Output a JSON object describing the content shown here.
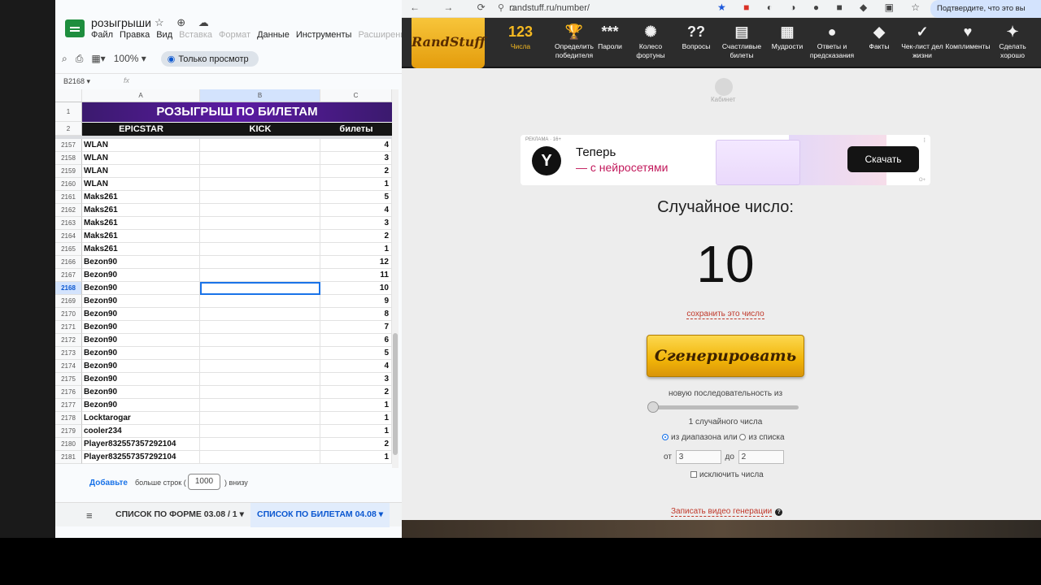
{
  "sheets": {
    "doc_title": "розыгрыши",
    "title_icons": "☆ ⊕ ☁",
    "menu": [
      {
        "label": "Файл",
        "dim": false
      },
      {
        "label": "Правка",
        "dim": false
      },
      {
        "label": "Вид",
        "dim": false
      },
      {
        "label": "Вставка",
        "dim": true
      },
      {
        "label": "Формат",
        "dim": true
      },
      {
        "label": "Данные",
        "dim": false
      },
      {
        "label": "Инструменты",
        "dim": false
      },
      {
        "label": "Расширения",
        "dim": true
      }
    ],
    "zoom": "100%",
    "view_only_label": "Только просмотр",
    "name_box": "B2168",
    "fx": "fx",
    "columns": [
      "A",
      "B",
      "C"
    ],
    "banner_row_num": "1",
    "header_row_num": "2",
    "banner": "РОЗЫГРЫШ ПО БИЛЕТАМ",
    "headers": [
      "EPICSTAR",
      "KICK",
      "билеты"
    ],
    "rows": [
      {
        "n": "2157",
        "a": "WLAN",
        "c": "4"
      },
      {
        "n": "2158",
        "a": "WLAN",
        "c": "3"
      },
      {
        "n": "2159",
        "a": "WLAN",
        "c": "2"
      },
      {
        "n": "2160",
        "a": "WLAN",
        "c": "1"
      },
      {
        "n": "2161",
        "a": "Maks261",
        "c": "5"
      },
      {
        "n": "2162",
        "a": "Maks261",
        "c": "4"
      },
      {
        "n": "2163",
        "a": "Maks261",
        "c": "3"
      },
      {
        "n": "2164",
        "a": "Maks261",
        "c": "2"
      },
      {
        "n": "2165",
        "a": "Maks261",
        "c": "1"
      },
      {
        "n": "2166",
        "a": "Bezon90",
        "c": "12"
      },
      {
        "n": "2167",
        "a": "Bezon90",
        "c": "11"
      },
      {
        "n": "2168",
        "a": "Bezon90",
        "c": "10",
        "selected": true
      },
      {
        "n": "2169",
        "a": "Bezon90",
        "c": "9"
      },
      {
        "n": "2170",
        "a": "Bezon90",
        "c": "8"
      },
      {
        "n": "2171",
        "a": "Bezon90",
        "c": "7"
      },
      {
        "n": "2172",
        "a": "Bezon90",
        "c": "6"
      },
      {
        "n": "2173",
        "a": "Bezon90",
        "c": "5"
      },
      {
        "n": "2174",
        "a": "Bezon90",
        "c": "4"
      },
      {
        "n": "2175",
        "a": "Bezon90",
        "c": "3"
      },
      {
        "n": "2176",
        "a": "Bezon90",
        "c": "2"
      },
      {
        "n": "2177",
        "a": "Bezon90",
        "c": "1"
      },
      {
        "n": "2178",
        "a": "Locktarogar",
        "c": "1"
      },
      {
        "n": "2179",
        "a": "cooler234",
        "c": "1"
      },
      {
        "n": "2180",
        "a": "Player832557357292104",
        "c": "2"
      },
      {
        "n": "2181",
        "a": "Player832557357292104",
        "c": "1"
      }
    ],
    "add_link": "Добавьте",
    "add_text": "больше строк (",
    "add_value": "1000",
    "add_below": ") внизу",
    "tab_menu_icon": "≡",
    "tabs": [
      "СПИСОК ПО ФОРМЕ 03.08 / 1 ▾",
      "СПИСОК ПО БИЛЕТАМ 04.08 ▾"
    ]
  },
  "browser": {
    "nav_icons": "← → ⟳ ⌂",
    "url": "randstuff.ru/number/",
    "confirm_label": "Подтвердите, что это вы"
  },
  "randstuff": {
    "logo": "RandStuff",
    "nav": [
      {
        "icon": "123",
        "label": "Числа",
        "active": true
      },
      {
        "icon": "🏆",
        "label": "Определить победителя"
      },
      {
        "icon": "***",
        "label": "Пароли"
      },
      {
        "icon": "✺",
        "label": "Колесо фортуны"
      },
      {
        "icon": "??",
        "label": "Вопросы"
      },
      {
        "icon": "▤",
        "label": "Счастливые билеты"
      },
      {
        "icon": "▦",
        "label": "Мудрости"
      },
      {
        "icon": "●",
        "label": "Ответы и предсказания"
      },
      {
        "icon": "◆",
        "label": "Факты"
      },
      {
        "icon": "✓",
        "label": "Чек-лист дел жизни"
      },
      {
        "icon": "♥",
        "label": "Комплименты"
      },
      {
        "icon": "✦",
        "label": "Сделать хорошо"
      }
    ],
    "cabinet_label": "Кабинет",
    "ad": {
      "tag": "РЕКЛАМА · 16+",
      "logo_letter": "Y",
      "line1": "Теперь",
      "line2": "— с нейросетями",
      "button": "Скачать",
      "foot": "О+"
    },
    "result_title": "Случайное число:",
    "result_number": "10",
    "save_label": "сохранить это число",
    "generate_label": "Сгенерировать",
    "sequence_label": "новую последовательность из",
    "count_label": "1 случайного числа",
    "mode_range": "из диапазона или",
    "mode_list": "из списка",
    "from_label": "от",
    "from_value": "3",
    "to_label": "до",
    "to_value": "2",
    "exclude_label": "исключить числа",
    "video_label": "Записать видео генерации"
  }
}
